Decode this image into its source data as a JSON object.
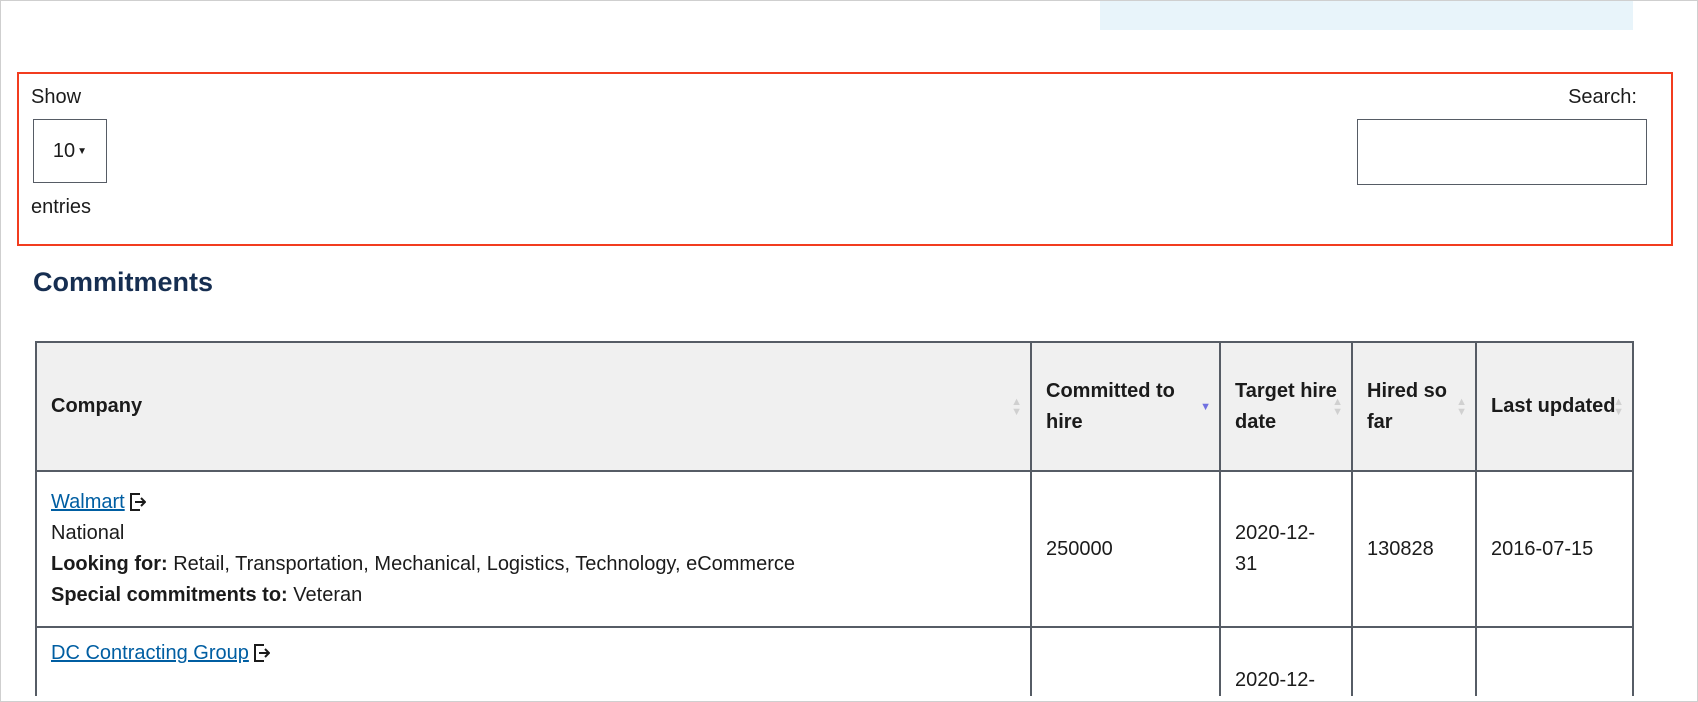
{
  "controls": {
    "show_label": "Show",
    "page_length": "10",
    "entries_label": "entries",
    "search_label": "Search:",
    "search_value": ""
  },
  "heading": "Commitments",
  "table": {
    "headers": [
      "Company",
      "Committed to hire",
      "Target hire date",
      "Hired so far",
      "Last updated"
    ],
    "sorted_column": "Committed to hire",
    "sort_direction": "descending",
    "rows": [
      {
        "company": "Walmart",
        "scope": "National",
        "looking_for_label": "Looking for:",
        "looking_for": "Retail, Transportation, Mechanical, Logistics, Technology, eCommerce",
        "special_label": "Special commitments to:",
        "special": "Veteran",
        "committed": "250000",
        "target_date": "2020-12-31",
        "hired": "130828",
        "updated": "2016-07-15"
      },
      {
        "company": "DC Contracting Group",
        "target_date": "2020-12-"
      }
    ]
  },
  "colors": {
    "link": "#005ea2",
    "heading": "#162e51",
    "highlight_border": "#f23c1f",
    "header_bg": "#f0f0f0"
  }
}
